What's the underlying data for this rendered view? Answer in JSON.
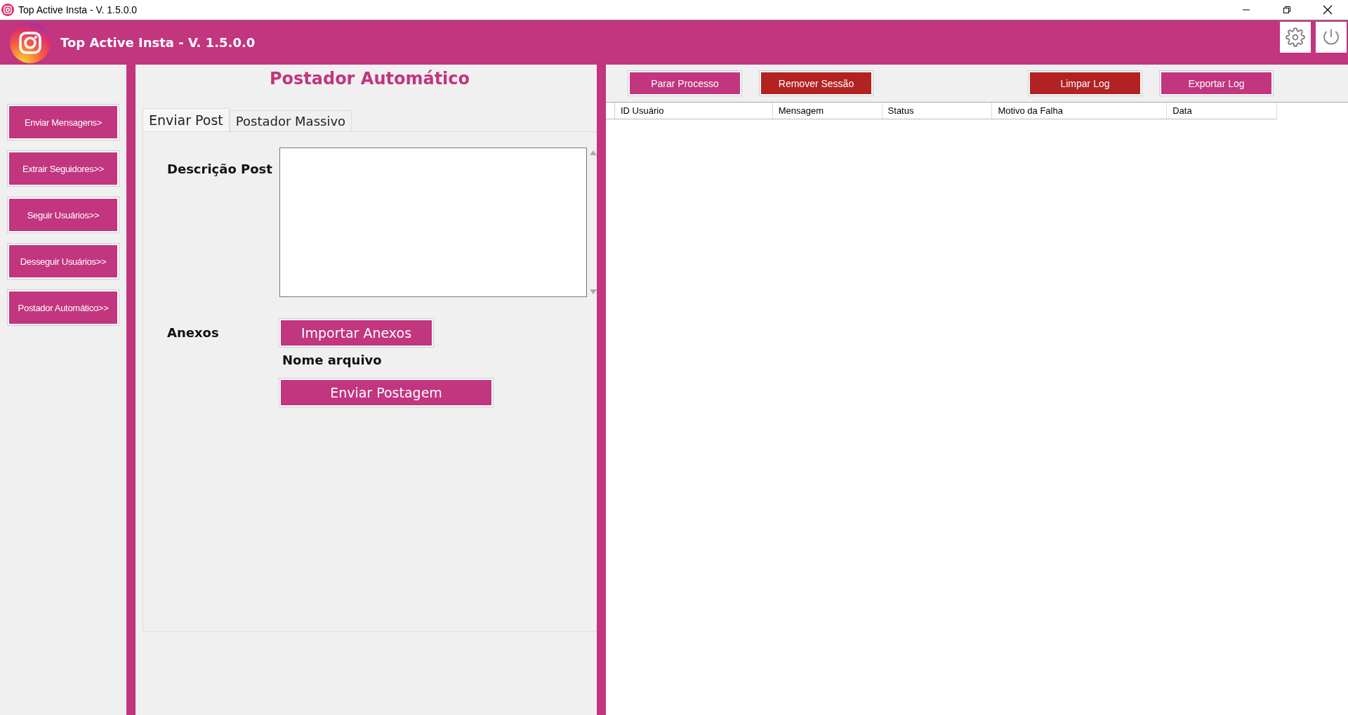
{
  "window": {
    "title": "Top Active Insta - V. 1.5.0.0"
  },
  "header": {
    "title": "Top Active Insta - V. 1.5.0.0"
  },
  "sidebar": {
    "items": [
      {
        "label": "Enviar Mensagens>"
      },
      {
        "label": "Extrair Seguidores>>"
      },
      {
        "label": "Seguir Usuários>>"
      },
      {
        "label": "Desseguir Usuários>>"
      },
      {
        "label": "Postador Automático>>"
      }
    ]
  },
  "main": {
    "title": "Postador Automático",
    "tabs": [
      {
        "label": "Enviar Post",
        "selected": true
      },
      {
        "label": "Postador Massivo",
        "selected": false
      }
    ],
    "description_label": "Descrição Post",
    "attachments_label": "Anexos",
    "import_button": "Importar Anexos",
    "file_name": "Nome arquivo",
    "send_button": "Enviar Postagem"
  },
  "toolbar": {
    "buttons": [
      {
        "label": "Parar Processo",
        "color": "#c2357f"
      },
      {
        "label": "Remover Sessão",
        "color": "#b22222"
      },
      {
        "label": "Limpar Log",
        "color": "#b22222"
      },
      {
        "label": "Exportar Log",
        "color": "#c2357f"
      }
    ]
  },
  "table": {
    "columns": [
      "ID Usuário",
      "Mensagem",
      "Status",
      "Motivo da Falha",
      "Data"
    ]
  }
}
